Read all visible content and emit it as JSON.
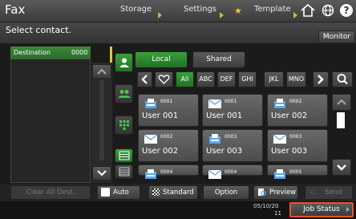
{
  "header": {
    "title": "Fax",
    "tabs": [
      "Storage",
      "Settings",
      "Template"
    ]
  },
  "prompt": "Select contact.",
  "monitor_label": "Monitor",
  "destination": {
    "label": "Destination",
    "count": "0000"
  },
  "tabs": {
    "local": "Local",
    "shared": "Shared"
  },
  "index": [
    "All",
    "ABC",
    "DEF",
    "GHI",
    "JKL",
    "MNO"
  ],
  "contacts": [
    {
      "num": "0001",
      "name": "User 001",
      "type": "fax"
    },
    {
      "num": "0001",
      "name": "User 001",
      "type": "email"
    },
    {
      "num": "0002",
      "name": "User 002",
      "type": "fax"
    },
    {
      "num": "0002",
      "name": "User 002",
      "type": "email"
    },
    {
      "num": "0003",
      "name": "User 003",
      "type": "fax"
    },
    {
      "num": "0003",
      "name": "User 003",
      "type": "email"
    },
    {
      "num": "0004",
      "name": "",
      "type": "fax"
    },
    {
      "num": "0004",
      "name": "",
      "type": "email"
    },
    {
      "num": "0005",
      "name": "",
      "type": "fax"
    }
  ],
  "bottom": {
    "clear": "Clear All Dest.",
    "auto": "Auto",
    "standard": "Standard",
    "option": "Option",
    "preview": "Preview",
    "send": "Send"
  },
  "status": {
    "date": "05/10/20",
    "time": "11",
    "job_status": "Job Status"
  },
  "colors": {
    "accent_green": "#3aa03a",
    "highlight": "#e8522f"
  }
}
